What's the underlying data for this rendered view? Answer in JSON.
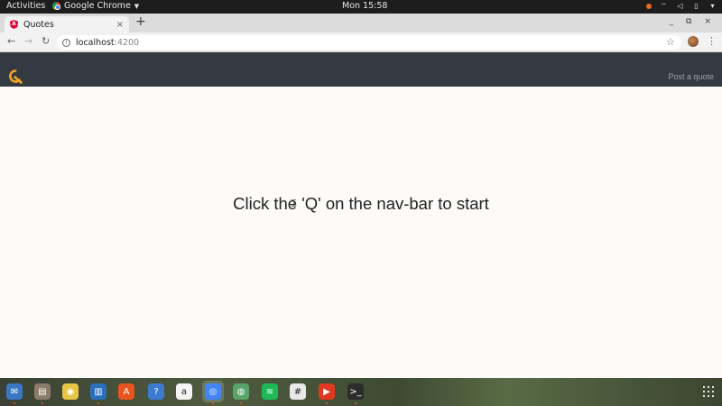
{
  "topbar": {
    "activities": "Activities",
    "app_name": "Google Chrome",
    "clock": "Mon 15:58"
  },
  "tab": {
    "title": "Quotes",
    "close": "×"
  },
  "newtab": "+",
  "window_controls": [
    "_",
    "⧉",
    "×"
  ],
  "address": {
    "host": "localhost",
    "port": ":4200"
  },
  "app": {
    "post_link": "Post a quote",
    "message": "Click the 'Q' on the nav-bar to start",
    "brand_color": "#f5a623",
    "navbar_color": "#333a42"
  },
  "dock": {
    "items": [
      {
        "icon": "thunderbird-icon",
        "glyph": "✉",
        "bg": "#3b78c4"
      },
      {
        "icon": "files-icon",
        "glyph": "▤",
        "bg": "#8a7b6a"
      },
      {
        "icon": "rhythmbox-icon",
        "glyph": "◉",
        "bg": "#e8c547"
      },
      {
        "icon": "writer-icon",
        "glyph": "▥",
        "bg": "#2a6fbc"
      },
      {
        "icon": "software-icon",
        "glyph": "A",
        "bg": "#e9541e"
      },
      {
        "icon": "help-icon",
        "glyph": "?",
        "bg": "#3d7bd1"
      },
      {
        "icon": "amazon-icon",
        "glyph": "a",
        "bg": "#f5f5f5"
      },
      {
        "icon": "chrome-icon",
        "glyph": "◎",
        "bg": "#4285f4"
      },
      {
        "icon": "browser-icon",
        "glyph": "◍",
        "bg": "#5aa469"
      },
      {
        "icon": "spotify-icon",
        "glyph": "≋",
        "bg": "#1db954"
      },
      {
        "icon": "slack-icon",
        "glyph": "#",
        "bg": "#e8e8e8"
      },
      {
        "icon": "video-icon",
        "glyph": "▶",
        "bg": "#e0391f"
      },
      {
        "icon": "terminal-icon",
        "glyph": ">_",
        "bg": "#2c2c2c"
      }
    ]
  }
}
